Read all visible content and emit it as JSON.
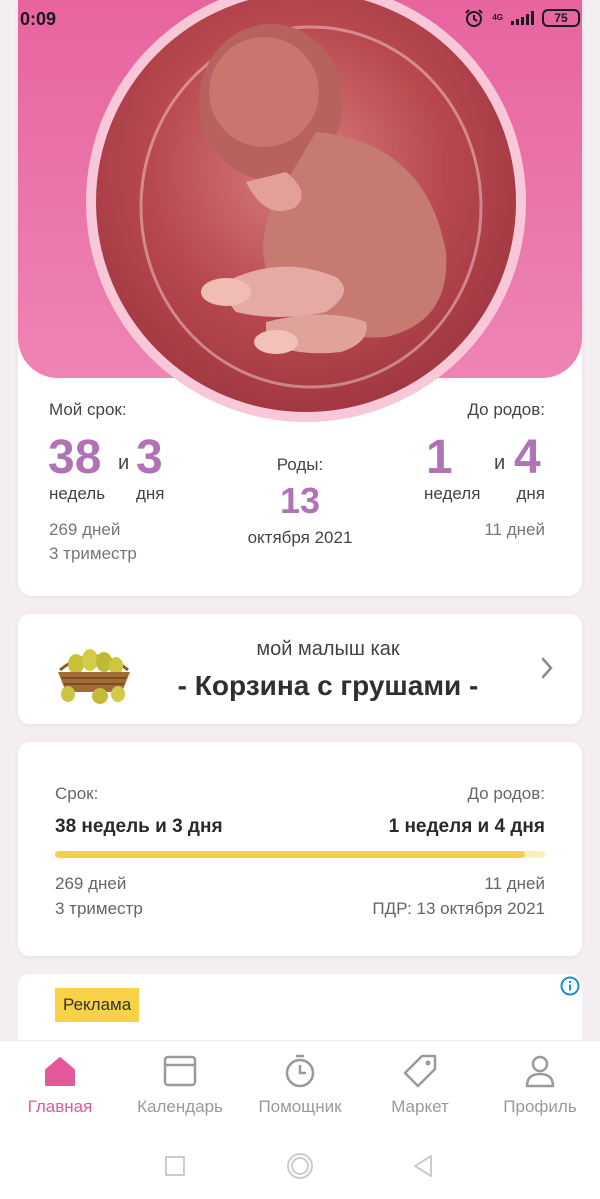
{
  "status": {
    "time": "0:09",
    "network": "4G",
    "battery": "75"
  },
  "overview": {
    "my_term_label": "Мой срок:",
    "weeks_value": "38",
    "and_word": "и",
    "days_value": "3",
    "weeks_unit": "недель",
    "days_unit": "дня",
    "total_days": "269 дней",
    "trimester": "3 триместр",
    "birth_label": "Роды:",
    "birth_day": "13",
    "birth_month": "октября 2021",
    "until_label": "До родов:",
    "left_weeks_value": "1",
    "left_and_word": "и",
    "left_days_value": "4",
    "left_weeks_unit": "неделя",
    "left_days_unit": "дня",
    "left_total_days": "11 дней"
  },
  "fruit": {
    "title": "мой малыш как",
    "name": "- Корзина с грушами -",
    "icon": "pear-basket-icon"
  },
  "progress": {
    "term_label": "Срок:",
    "term_value": "38 недель и 3 дня",
    "until_label": "До родов:",
    "until_value": "1 неделя и 4 дня",
    "progress_percent": 96,
    "days": "269 дней",
    "trimester": "3 триместр",
    "days_left": "11 дней",
    "due_date": "ПДР: 13 октября 2021"
  },
  "ad": {
    "badge": "Реклама"
  },
  "tabs": [
    {
      "label": "Главная",
      "icon": "home-icon",
      "active": true
    },
    {
      "label": "Календарь",
      "icon": "calendar-icon",
      "active": false
    },
    {
      "label": "Помощник",
      "icon": "stopwatch-icon",
      "active": false
    },
    {
      "label": "Маркет",
      "icon": "tag-icon",
      "active": false
    },
    {
      "label": "Профиль",
      "icon": "profile-icon",
      "active": false
    }
  ],
  "colors": {
    "accent": "#e2589a",
    "number_purple": "#b073b5",
    "hero_pink": "#e8649f",
    "progress_fill": "#f4cf4e",
    "ad_badge": "#f7d247"
  }
}
